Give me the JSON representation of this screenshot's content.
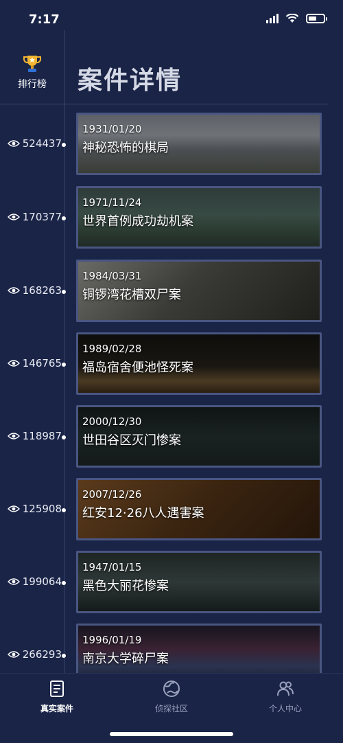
{
  "status_bar": {
    "time": "7:17"
  },
  "header": {
    "rank_label": "排行榜",
    "title": "案件详情"
  },
  "cases": [
    {
      "views": "524437",
      "date": "1931/01/20",
      "title": "神秘恐怖的棋局"
    },
    {
      "views": "170377",
      "date": "1971/11/24",
      "title": "世界首例成功劫机案"
    },
    {
      "views": "168263",
      "date": "1984/03/31",
      "title": "铜锣湾花槽双尸案"
    },
    {
      "views": "146765",
      "date": "1989/02/28",
      "title": "福岛宿舍便池怪死案"
    },
    {
      "views": "118987",
      "date": "2000/12/30",
      "title": "世田谷区灭门惨案"
    },
    {
      "views": "125908",
      "date": "2007/12/26",
      "title": "红安12·26八人遇害案"
    },
    {
      "views": "199064",
      "date": "1947/01/15",
      "title": "黑色大丽花惨案"
    },
    {
      "views": "266293",
      "date": "1996/01/19",
      "title": "南京大学碎尸案"
    }
  ],
  "tabs": [
    {
      "label": "真实案件",
      "icon": "document-icon",
      "active": true
    },
    {
      "label": "侦探社区",
      "icon": "globe-icon",
      "active": false
    },
    {
      "label": "个人中心",
      "icon": "people-icon",
      "active": false
    }
  ],
  "colors": {
    "background": "#1a2447",
    "card_border": "#4a5682",
    "inactive_tab": "#9aa2bd",
    "trophy": "#f2b632"
  }
}
